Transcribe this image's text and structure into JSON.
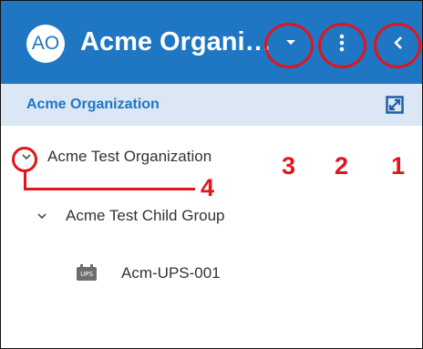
{
  "header": {
    "avatar_initials": "AO",
    "title": "Acme Organiz..."
  },
  "subheader": {
    "title": "Acme Organization"
  },
  "tree": {
    "items": [
      {
        "label": "Acme Test Organization",
        "level": 0
      },
      {
        "label": "Acme Test Child Group",
        "level": 1
      },
      {
        "label": "Acm-UPS-001",
        "level": 2,
        "device_icon_text": "UPS"
      }
    ]
  },
  "callouts": [
    "1",
    "2",
    "3",
    "4"
  ],
  "colors": {
    "header_bg": "#1f76c2",
    "subheader_bg": "#dbe7f4",
    "callout_red": "#e3141b"
  },
  "icons": [
    "chevron-down-icon",
    "more-vertical-icon",
    "chevron-left-icon",
    "expand-icon",
    "ups-device-icon"
  ]
}
